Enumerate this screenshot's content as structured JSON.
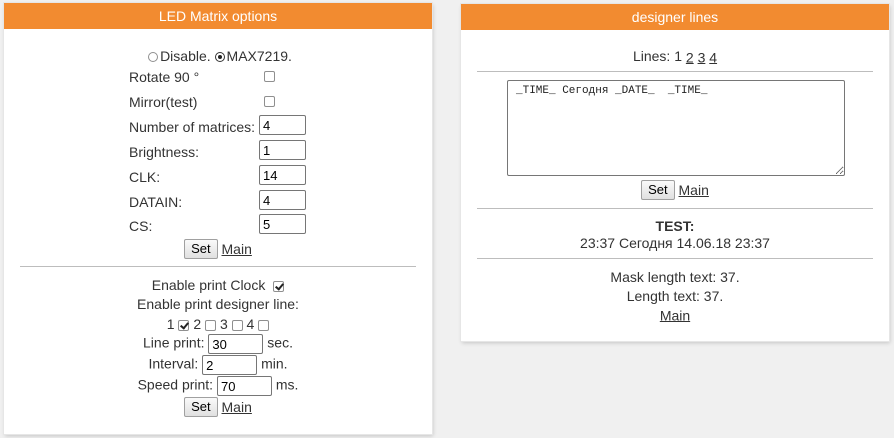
{
  "led": {
    "title": "LED Matrix options",
    "mode": {
      "disable_label": "Disable.",
      "max_label": "MAX7219.",
      "selected": "MAX7219."
    },
    "rotate": {
      "label": "Rotate 90 °",
      "checked": false
    },
    "mirror": {
      "label": "Mirror(test)",
      "checked": false
    },
    "fields": [
      {
        "label": "Number of matrices:",
        "value": "4"
      },
      {
        "label": "Brightness:",
        "value": "1"
      },
      {
        "label": "CLK:",
        "value": "14"
      },
      {
        "label": "DATAIN:",
        "value": "4"
      },
      {
        "label": "CS:",
        "value": "5"
      }
    ],
    "set_label": "Set",
    "main_label": "Main",
    "clock": {
      "label": "Enable print Clock",
      "checked": true
    },
    "designer_label": "Enable print designer line:",
    "designer_lines": [
      {
        "num": "1",
        "checked": true
      },
      {
        "num": "2",
        "checked": false
      },
      {
        "num": "3",
        "checked": false
      },
      {
        "num": "4",
        "checked": false
      }
    ],
    "line_print": {
      "label": "Line print:",
      "value": "30",
      "unit": "sec."
    },
    "interval": {
      "label": "Interval:",
      "value": "2",
      "unit": "min."
    },
    "speed": {
      "label": "Speed print:",
      "value": "70",
      "unit": "ms."
    },
    "set2_label": "Set",
    "main2_label": "Main"
  },
  "designer": {
    "title": "designer lines",
    "lines_label": "Lines:",
    "lines": [
      "1",
      "2",
      "3",
      "4"
    ],
    "textarea_value": "_TIME_ Сегодня _DATE_  _TIME_",
    "set_label": "Set",
    "main_label": "Main",
    "test_label": "TEST:",
    "test_value": "23:37 Сегодня 14.06.18 23:37",
    "mask_length": "Mask length text: 37.",
    "length_text": "Length text: 37.",
    "main2_label": "Main"
  }
}
